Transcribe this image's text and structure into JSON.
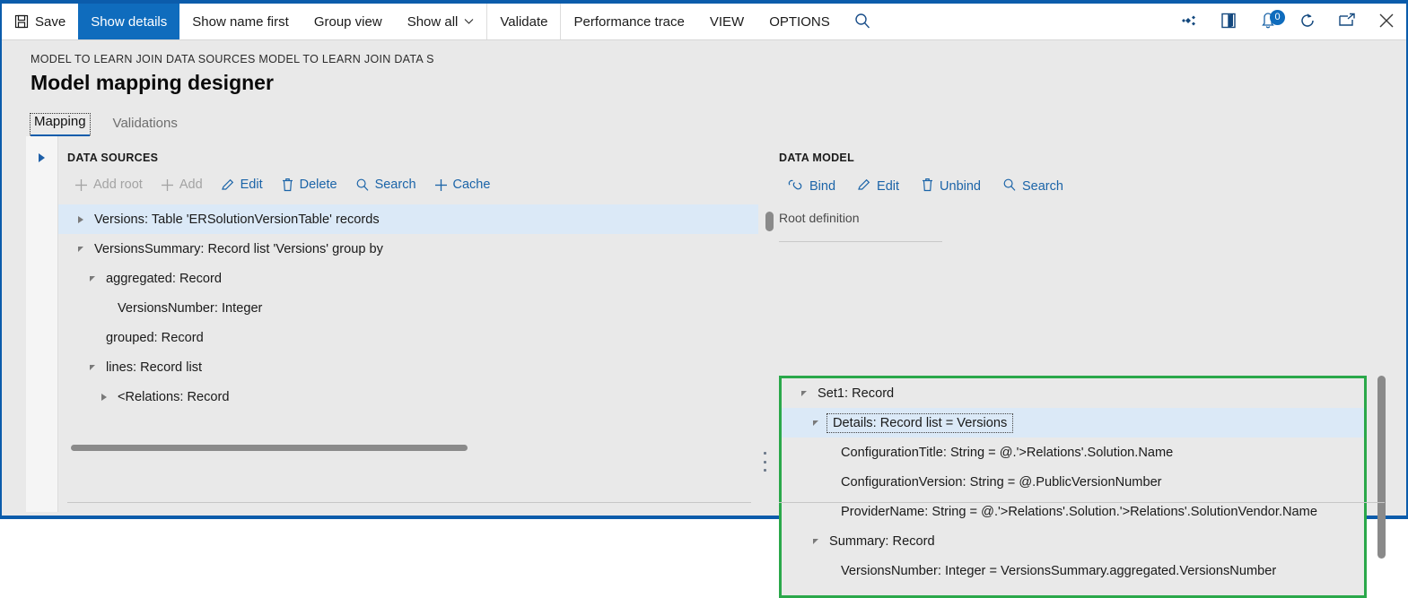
{
  "window": {
    "accent_color": "#0b5cab",
    "highlight_color": "#0f6cbd",
    "selection_color": "#dbe9f7",
    "green_box_color": "#2aa84a"
  },
  "commandbar": {
    "items": [
      {
        "label": "Save",
        "icon": "save-icon",
        "active": false,
        "separator": false
      },
      {
        "label": "Show details",
        "icon": "",
        "active": true,
        "separator": false
      },
      {
        "label": "Show name first",
        "icon": "",
        "active": false,
        "separator": false
      },
      {
        "label": "Group view",
        "icon": "",
        "active": false,
        "separator": false
      },
      {
        "label": "Show all",
        "icon": "chevron-down-icon",
        "active": false,
        "separator": false
      },
      {
        "label": "Validate",
        "icon": "",
        "active": false,
        "separator": true
      },
      {
        "label": "Performance trace",
        "icon": "",
        "active": false,
        "separator": true
      },
      {
        "label": "VIEW",
        "icon": "",
        "active": false,
        "separator": false
      },
      {
        "label": "OPTIONS",
        "icon": "",
        "active": false,
        "separator": false
      }
    ],
    "search_icon": "search-icon",
    "right_icons": [
      {
        "name": "settings-diamond-icon",
        "badge": ""
      },
      {
        "name": "open-book-icon",
        "badge": ""
      },
      {
        "name": "notifications-icon",
        "badge": "0"
      },
      {
        "name": "refresh-icon",
        "badge": ""
      },
      {
        "name": "popout-icon",
        "badge": ""
      },
      {
        "name": "close-icon",
        "badge": ""
      }
    ]
  },
  "header": {
    "breadcrumb": "MODEL TO LEARN JOIN DATA SOURCES MODEL TO LEARN JOIN DATA S",
    "title": "Model mapping designer"
  },
  "tabs": [
    {
      "label": "Mapping",
      "active": true
    },
    {
      "label": "Validations",
      "active": false
    }
  ],
  "left_panel": {
    "section_title": "DATA SOURCES",
    "toolbar": [
      {
        "label": "Add root",
        "icon": "plus-icon",
        "disabled": true
      },
      {
        "label": "Add",
        "icon": "plus-icon",
        "disabled": true
      },
      {
        "label": "Edit",
        "icon": "pencil-icon",
        "disabled": false
      },
      {
        "label": "Delete",
        "icon": "trash-icon",
        "disabled": false
      },
      {
        "label": "Search",
        "icon": "search-icon",
        "disabled": false
      },
      {
        "label": "Cache",
        "icon": "plus-icon",
        "disabled": false
      }
    ],
    "tree": [
      {
        "label": "Versions: Table 'ERSolutionVersionTable' records",
        "indent": 0,
        "twisty": "collapsed",
        "selected": true
      },
      {
        "label": "VersionsSummary: Record list 'Versions' group by",
        "indent": 0,
        "twisty": "expanded",
        "selected": false
      },
      {
        "label": "aggregated: Record",
        "indent": 1,
        "twisty": "expanded",
        "selected": false
      },
      {
        "label": "VersionsNumber: Integer",
        "indent": 2,
        "twisty": "none",
        "selected": false
      },
      {
        "label": "grouped: Record",
        "indent": 1,
        "twisty": "none",
        "selected": false
      },
      {
        "label": "lines: Record list",
        "indent": 0,
        "twisty": "expanded",
        "selected": false
      },
      {
        "label": "<Relations: Record",
        "indent": 1,
        "twisty": "collapsed",
        "selected": false
      }
    ]
  },
  "right_panel": {
    "section_title": "DATA MODEL",
    "toolbar": [
      {
        "label": "Bind",
        "icon": "link-icon"
      },
      {
        "label": "Edit",
        "icon": "pencil-icon"
      },
      {
        "label": "Unbind",
        "icon": "trash-icon"
      },
      {
        "label": "Search",
        "icon": "search-icon"
      }
    ],
    "root_definition": "Root definition",
    "tree": [
      {
        "label": "Set1: Record",
        "indent": 0,
        "twisty": "expanded",
        "selected": false,
        "focus": false
      },
      {
        "label": "Details: Record list = Versions",
        "indent": 1,
        "twisty": "expanded",
        "selected": true,
        "focus": true
      },
      {
        "label": "ConfigurationTitle: String = @.'>Relations'.Solution.Name",
        "indent": 2,
        "twisty": "none",
        "selected": false,
        "focus": false
      },
      {
        "label": "ConfigurationVersion: String = @.PublicVersionNumber",
        "indent": 2,
        "twisty": "none",
        "selected": false,
        "focus": false
      },
      {
        "label": "ProviderName: String = @.'>Relations'.Solution.'>Relations'.SolutionVendor.Name",
        "indent": 2,
        "twisty": "none",
        "selected": false,
        "focus": false
      },
      {
        "label": "Summary: Record",
        "indent": 1,
        "twisty": "expanded",
        "selected": false,
        "focus": false
      },
      {
        "label": "VersionsNumber: Integer = VersionsSummary.aggregated.VersionsNumber",
        "indent": 2,
        "twisty": "none",
        "selected": false,
        "focus": false
      }
    ]
  }
}
